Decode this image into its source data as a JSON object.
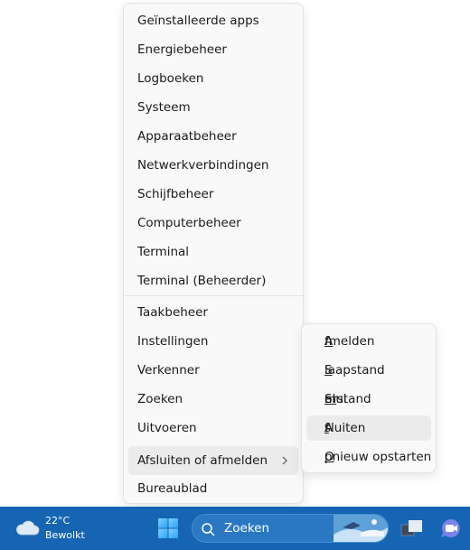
{
  "menu": {
    "items": [
      {
        "label": "Geïnstalleerde apps"
      },
      {
        "label": "Energiebeheer"
      },
      {
        "label": "Logboeken"
      },
      {
        "label": "Systeem"
      },
      {
        "label": "Apparaatbeheer"
      },
      {
        "label": "Netwerkverbindingen"
      },
      {
        "label": "Schijfbeheer"
      },
      {
        "label": "Computerbeheer"
      },
      {
        "label": "Terminal"
      },
      {
        "label": "Terminal (Beheerder)"
      },
      {
        "label": "Taakbeheer"
      },
      {
        "label": "Instellingen"
      },
      {
        "label": "Verkenner"
      },
      {
        "label": "Zoeken"
      },
      {
        "label": "Uitvoeren"
      },
      {
        "label": "Afsluiten of afmelden"
      },
      {
        "label": "Bureaublad"
      }
    ]
  },
  "submenu": {
    "items": [
      {
        "pre": "",
        "key": "A",
        "post": "fmelden"
      },
      {
        "pre": "",
        "key": "S",
        "post": "laapstand"
      },
      {
        "pre": "Slui",
        "key": "m",
        "post": "erstand"
      },
      {
        "pre": "A",
        "key": "f",
        "post": "sluiten"
      },
      {
        "pre": "",
        "key": "O",
        "post": "pnieuw opstarten"
      }
    ]
  },
  "taskbar": {
    "weather": {
      "temp": "22°C",
      "condition": "Bewolkt",
      "icon": "cloud-icon"
    },
    "search": {
      "placeholder": "Zoeken"
    },
    "accent": "#1565b3"
  }
}
